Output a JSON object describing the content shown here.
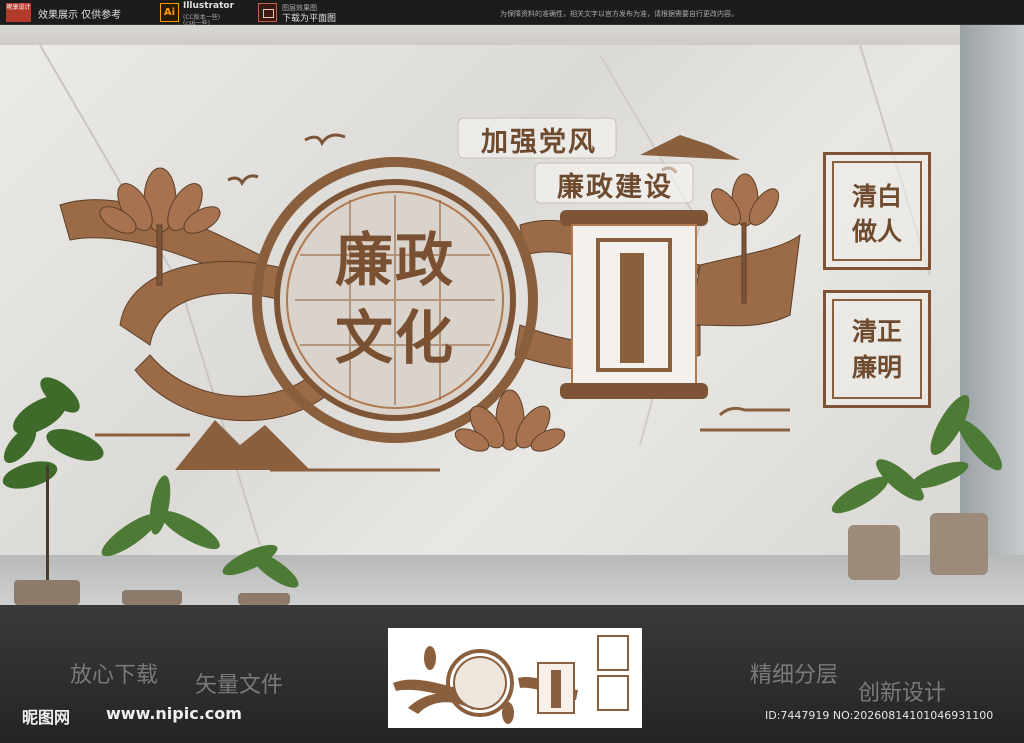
{
  "topbar": {
    "logo_text": "昵享设计",
    "notice_1": "效果展示 仅供参考",
    "ai_icon_label": "Ai",
    "ai_label": "Illustrator",
    "ai_sub": "(CC版本一些)",
    "ai_sub2": "(cs6一些)",
    "ps_label": "图层效果图",
    "ps_sub": "下载为平面图",
    "copyright": "为保障资料的准确性，相关文字以官方发布为准，请根据需要自行更改内容。"
  },
  "wall": {
    "slogan_1": "加强党风",
    "slogan_2": "廉政建设",
    "medallion_1": "廉政",
    "medallion_2": "文化",
    "plaque_1_line1": "清白",
    "plaque_1_line2": "做人",
    "plaque_2_line1": "清正",
    "plaque_2_line2": "廉明"
  },
  "bottom": {
    "word_1": "放心下载",
    "word_2": "矢量文件",
    "word_3": "精细分层",
    "word_4": "创新设计",
    "site_name": "昵图网",
    "site_url": "www.nipic.com",
    "id_text": "ID:7447919 NO:20260814101046931100"
  },
  "colors": {
    "bronze": "#8a5f3e",
    "bronze_light": "#b07a52",
    "bronze_dark": "#5e3f28",
    "leaf": "#3f6b2a"
  }
}
